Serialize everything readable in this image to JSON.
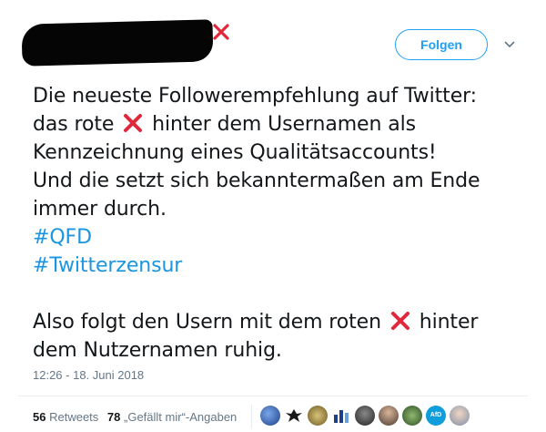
{
  "tweet": {
    "follow_label": "Folgen",
    "lines": [
      {
        "text": "Die neueste Followerempfehlung auf Twitter:"
      },
      {
        "before": "das rote",
        "after": "hinter dem Usernamen als"
      },
      {
        "text": "Kennzeichnung eines Qualitätsaccounts!"
      },
      {
        "text": "Und die setzt sich bekanntermaßen am Ende"
      },
      {
        "text": "immer durch."
      }
    ],
    "hashtags": [
      "#QFD",
      "#Twitterzensur"
    ],
    "closing": {
      "before": "Also folgt den Usern mit dem roten",
      "after": "hinter",
      "line2": "dem Nutzernamen ruhig."
    },
    "timestamp": "12:26 - 18. Juni 2018"
  },
  "stats": {
    "retweets_count": "56",
    "retweets_label": "Retweets",
    "likes_count": "78",
    "likes_label": "„Gefällt mir“-Angaben"
  },
  "avatars": {
    "afd_label": "AfD"
  },
  "colors": {
    "accent": "#1da1f2",
    "hashtag": "#1b95e0",
    "xmark": "#e0283a",
    "muted": "#657786"
  }
}
